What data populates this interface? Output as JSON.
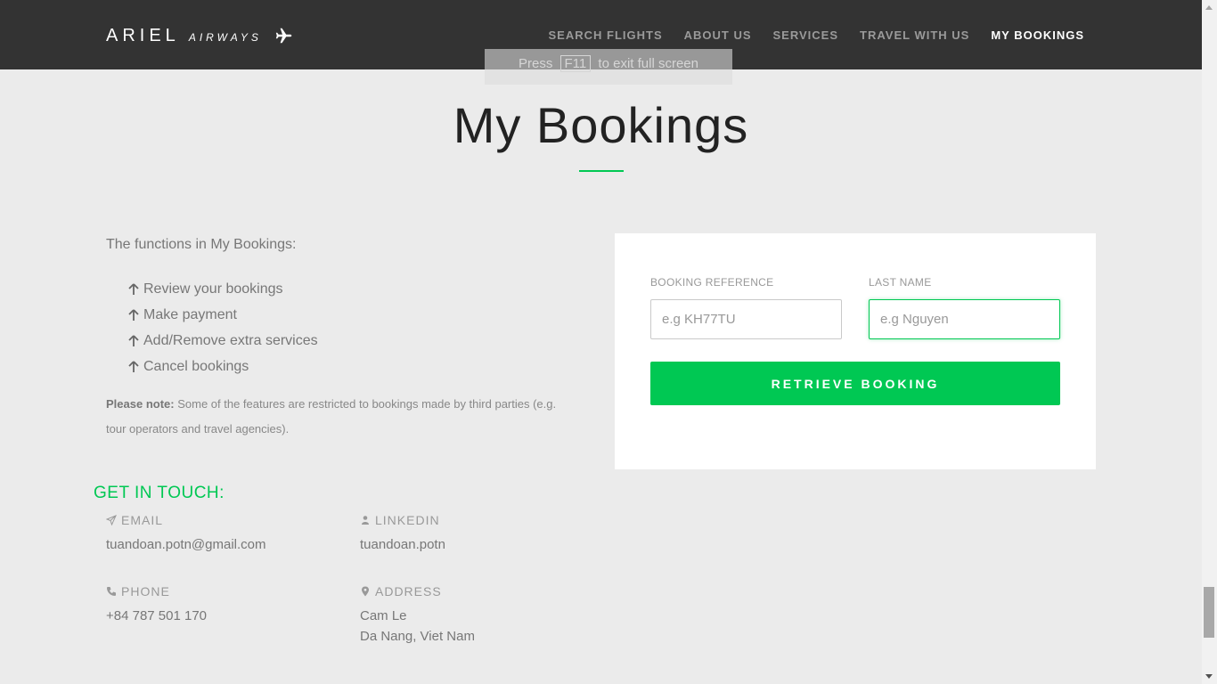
{
  "brand": {
    "name": "ARIEL",
    "tagline": "AIRWAYS",
    "icon": "airplane-icon"
  },
  "nav": {
    "items": [
      {
        "label": "SEARCH FLIGHTS"
      },
      {
        "label": "ABOUT US"
      },
      {
        "label": "SERVICES"
      },
      {
        "label": "TRAVEL WITH US"
      },
      {
        "label": "MY BOOKINGS",
        "active": true
      }
    ]
  },
  "fullscreen_hint": {
    "prefix": "Press",
    "key": "F11",
    "suffix": "to exit full screen"
  },
  "page": {
    "title": "My Bookings"
  },
  "functions": {
    "intro": "The functions in My Bookings:",
    "items": [
      "Review your bookings",
      "Make payment",
      "Add/Remove extra services",
      "Cancel bookings"
    ],
    "note_bold": "Please note:",
    "note_text": "Some of the features are restricted to bookings made by third parties (e.g. tour operators and travel agencies)."
  },
  "form": {
    "booking_ref_label": "BOOKING REFERENCE",
    "booking_ref_placeholder": "e.g KH77TU",
    "booking_ref_value": "",
    "last_name_label": "LAST NAME",
    "last_name_placeholder": "e.g Nguyen",
    "last_name_value": "",
    "submit_label": "RETRIEVE BOOKING"
  },
  "contact": {
    "heading": "GET IN TOUCH:",
    "email_label": "EMAIL",
    "email_value": "tuandoan.potn@gmail.com",
    "linkedin_label": "LINKEDIN",
    "linkedin_value": "tuandoan.potn",
    "phone_label": "PHONE",
    "phone_value": "+84 787 501 170",
    "address_label": "ADDRESS",
    "address_line1": "Cam Le",
    "address_line2": "Da Nang, Viet Nam"
  },
  "colors": {
    "accent": "#00c853",
    "navbar": "#333333",
    "background": "#ebebeb"
  }
}
